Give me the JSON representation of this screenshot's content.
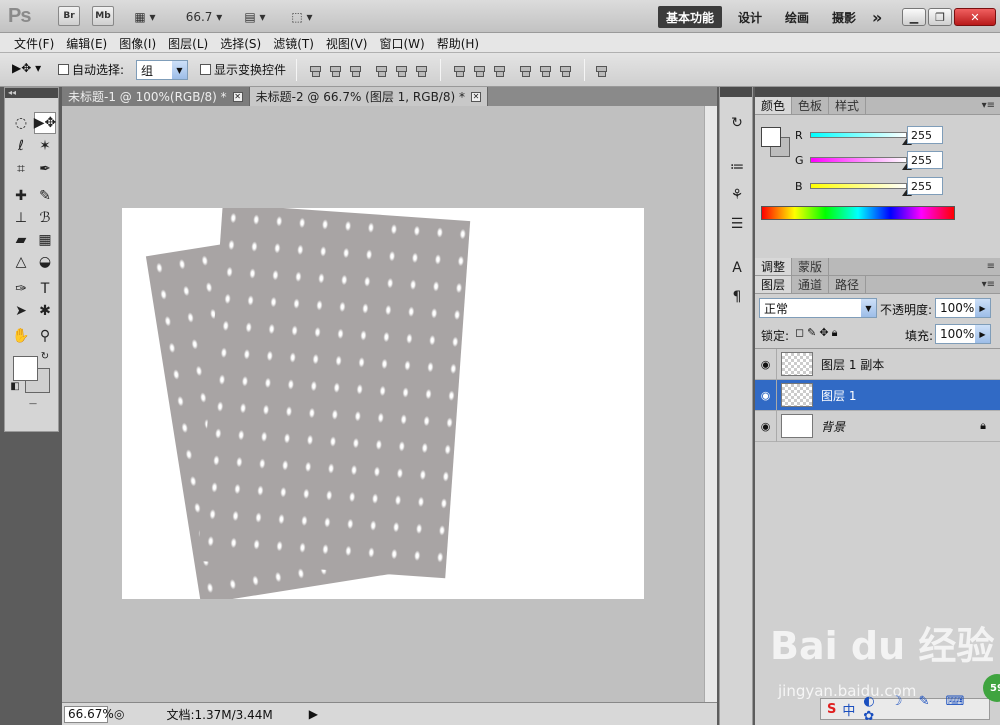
{
  "titlebar": {
    "app_logo": "Ps",
    "bridge": "Br",
    "minibridge": "Mb",
    "zoom": "66.7",
    "workspaces": [
      "基本功能",
      "设计",
      "绘画",
      "摄影"
    ],
    "more": "»"
  },
  "menubar": {
    "items": [
      "文件(F)",
      "编辑(E)",
      "图像(I)",
      "图层(L)",
      "选择(S)",
      "滤镜(T)",
      "视图(V)",
      "窗口(W)",
      "帮助(H)"
    ]
  },
  "options": {
    "auto_select_label": "自动选择:",
    "auto_select_value": "组",
    "show_transform_label": "显示变换控件"
  },
  "documents": {
    "tabs": [
      {
        "label": "未标题-1 @ 100%(RGB/8) *"
      },
      {
        "label": "未标题-2 @ 66.7% (图层 1, RGB/8) *"
      }
    ],
    "close_glyph": "✕"
  },
  "status": {
    "zoom": "66.67%",
    "doc_info": "文档:1.37M/3.44M"
  },
  "color_panel": {
    "tabs": [
      "颜色",
      "色板",
      "样式"
    ],
    "channels": [
      {
        "label": "R",
        "value": "255",
        "color": "#00e5e5"
      },
      {
        "label": "G",
        "value": "255",
        "color": "#e020e0"
      },
      {
        "label": "B",
        "value": "255",
        "color": "#e8e820"
      }
    ]
  },
  "adjust_panel": {
    "tabs": [
      "调整",
      "蒙版"
    ]
  },
  "layers_panel": {
    "tabs": [
      "图层",
      "通道",
      "路径"
    ],
    "blend_mode": "正常",
    "opacity_label": "不透明度:",
    "opacity_value": "100%",
    "lock_label": "锁定:",
    "fill_label": "填充:",
    "fill_value": "100%",
    "layers": [
      {
        "name": "图层 1 副本",
        "active": false
      },
      {
        "name": "图层 1",
        "active": true
      },
      {
        "name": "背景",
        "active": false
      }
    ]
  },
  "watermark": {
    "brand": "Bai du 经验",
    "url": "jingyan.baidu.com"
  },
  "tray": {
    "label": "中",
    "badge": "59"
  }
}
